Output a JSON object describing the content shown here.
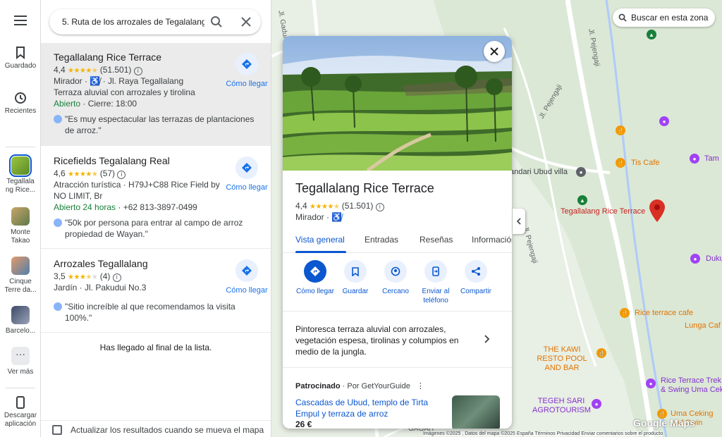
{
  "rail": {
    "menu_icon": "hamburger-menu-icon",
    "saved": "Guardado",
    "recent": "Recientes",
    "recents": [
      {
        "label": "Tegallala ng Rice..."
      },
      {
        "label": "Monte Takao"
      },
      {
        "label": "Cinque Terre da..."
      },
      {
        "label": "Barcelo..."
      }
    ],
    "more": "Ver más",
    "download": "Descargar aplicación"
  },
  "search": {
    "value": "5. Ruta de los arrozales de Tegalalang",
    "search_icon": "search-icon",
    "close_icon": "close-icon"
  },
  "results": [
    {
      "title": "Tegallalang Rice Terrace",
      "rating": "4,4",
      "reviews": "(51.501)",
      "line1": "Mirador · ♿̸ · Jl. Raya Tegallalang",
      "line2": "Terraza aluvial con arrozales y tirolina",
      "status_open": "Abierto",
      "status_rest": " · Cierre: 18:00",
      "quote": "\"Es muy espectacular las terrazas de plantaciones de arroz.\"",
      "directions": "Cómo llegar"
    },
    {
      "title": "Ricefields Tegalalang Real",
      "rating": "4,6",
      "reviews": "(57)",
      "line1": "Atracción turística · H79J+C88 Rice Field by",
      "line2": "NO LIMIT, Br",
      "status_open": "Abierto 24 horas",
      "status_rest": " · +62 813-3897-0499",
      "quote": "\"50k por persona para entrar al campo de arroz propiedad de Wayan.\"",
      "directions": "Cómo llegar"
    },
    {
      "title": "Arrozales Tegallalang",
      "rating": "3,5",
      "reviews": "(4)",
      "line1": "Jardín · Jl. Pakudui No.3",
      "quote": "\"Sitio increíble al que recomendamos la visita 100%.\"",
      "directions": "Cómo llegar"
    }
  ],
  "end_of_list": "Has llegado al final de la lista.",
  "update_results": "Actualizar los resultados cuando se mueva el mapa",
  "card": {
    "title": "Tegallalang Rice Terrace",
    "rating": "4,4",
    "reviews": "(51.501)",
    "category": "Mirador · ",
    "tabs": [
      "Vista general",
      "Entradas",
      "Reseñas",
      "Información"
    ],
    "actions": [
      {
        "label": "Cómo llegar",
        "icon": "directions-icon"
      },
      {
        "label": "Guardar",
        "icon": "bookmark-icon"
      },
      {
        "label": "Cercano",
        "icon": "nearby-icon"
      },
      {
        "label": "Enviar al teléfono",
        "icon": "send-to-phone-icon"
      },
      {
        "label": "Compartir",
        "icon": "share-icon"
      }
    ],
    "description": "Pintoresca terraza aluvial con arrozales, vegetación espesa, tirolinas y columpios en medio de la jungla.",
    "sponsored_label": "Patrocinado",
    "sponsored_by": " · Por GetYourGuide",
    "ad_title": "Cascadas de Ubud, templo de Tirta Empul y terraza de arroz",
    "ad_price": "26 €"
  },
  "map": {
    "search_area": "Buscar en esta zona",
    "labels": {
      "gadung": "Jl. Gadun",
      "pejeng1": "Jl. Pejengaji",
      "pejeng2": "Jl. Pejengaji",
      "pejeng3": "Jl. Pejengaji",
      "ubud_villa": "andari Ubud villa",
      "tis": "Tis Cafe",
      "tama": "Tam",
      "rice_terrace": "Tegallalang Rice Terrace",
      "duku": "Duku",
      "rice_cafe": "Rice terrace cafe",
      "lunga": "Lunga Caf",
      "kawi": "THE KAWI RESTO POOL AND BAR",
      "trek": "Rice Terrace Trek & Swing Uma Cek",
      "tegeh": "TEGEH SARI AGROTOURISM",
      "uma": "Uma Ceking and Swin",
      "gagah": "GAGAH"
    },
    "logo": "Google Maps",
    "credits": "Imágenes ©2025 , Datos del mapa ©2025    España    Términos    Privacidad    Enviar comentarios sobre el producto"
  },
  "colors": {
    "accent": "#0b57d0",
    "open": "#188038",
    "star": "#f4b400",
    "pin": "#d93025",
    "poi_orange": "#f29900",
    "poi_purple": "#a142f4",
    "road": "#ffffff",
    "water": "#aecbfa"
  }
}
